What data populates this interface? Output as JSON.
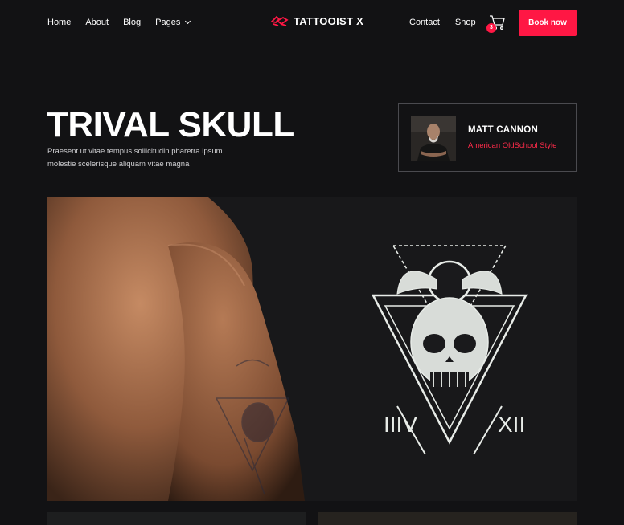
{
  "nav": {
    "left": [
      "Home",
      "About",
      "Blog",
      "Pages"
    ],
    "logo_text": "TATTOOIST X",
    "right": [
      "Contact",
      "Shop"
    ],
    "cart_count": "3",
    "book_label": "Book now"
  },
  "hero": {
    "title": "TRIVAL SKULL",
    "description": "Praesent ut vitae tempus sollicitudin pharetra ipsum molestie scelerisque aliquam vitae magna"
  },
  "artist": {
    "name": "MATT CANNON",
    "style": "American OldSchool Style"
  },
  "artwork": {
    "numeral_left": "IIIV",
    "numeral_right": "XII"
  },
  "colors": {
    "accent": "#ff1744",
    "background": "#121214",
    "card_border": "#4a4a4f"
  },
  "icons": {
    "logo": "tattoo-machine-icon",
    "pages_dropdown": "chevron-down-icon",
    "cart": "shopping-cart-icon"
  }
}
